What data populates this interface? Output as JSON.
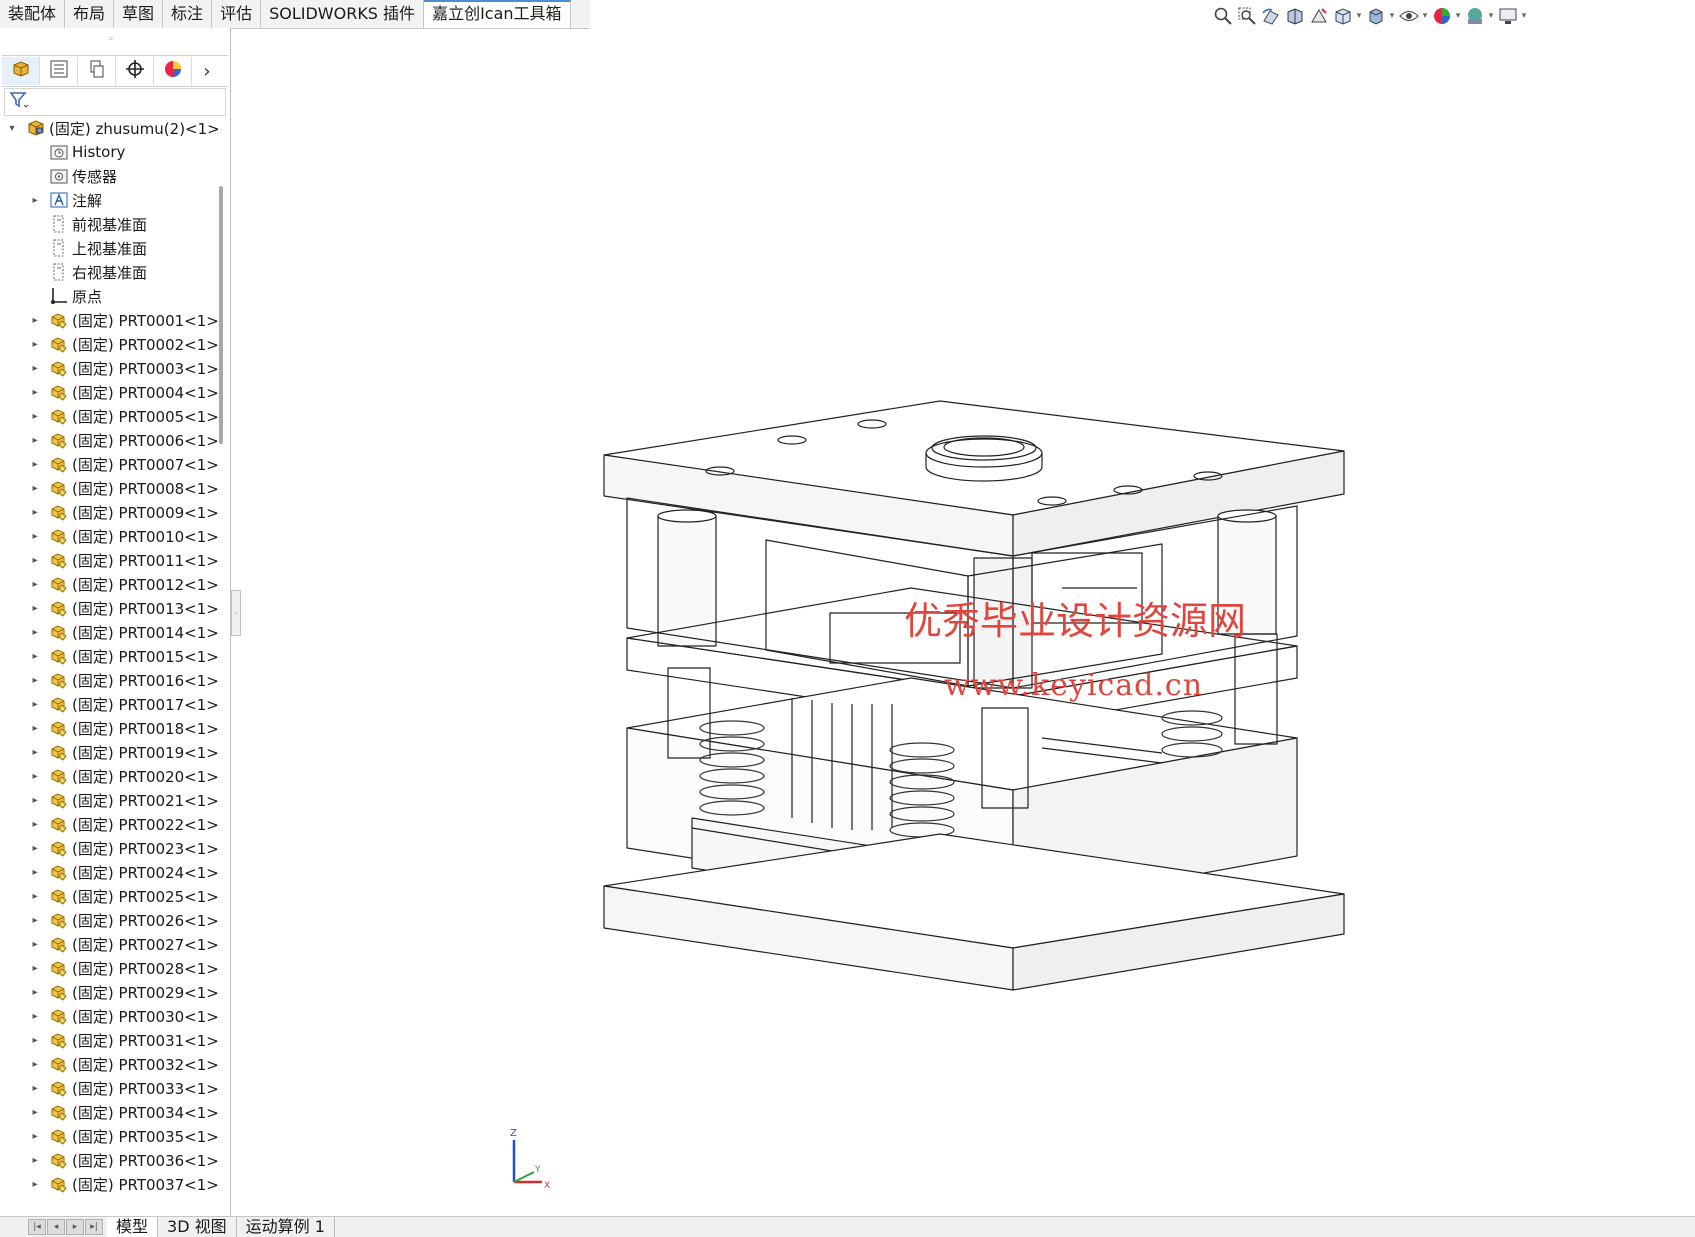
{
  "ribbon_tabs": [
    {
      "label": "装配体"
    },
    {
      "label": "布局"
    },
    {
      "label": "草图"
    },
    {
      "label": "标注"
    },
    {
      "label": "评估"
    },
    {
      "label": "SOLIDWORKS 插件"
    },
    {
      "label": "嘉立创Ican工具箱",
      "active": true
    }
  ],
  "view_toolbar": [
    {
      "icon": "zoom-to-fit-icon"
    },
    {
      "icon": "zoom-to-area-icon"
    },
    {
      "icon": "previous-view-icon"
    },
    {
      "icon": "section-view-icon"
    },
    {
      "icon": "dynamic-annotation-icon"
    },
    {
      "icon": "view-orientation-icon"
    },
    {
      "icon": "display-style-icon"
    },
    {
      "icon": "hide-show-items-icon"
    },
    {
      "icon": "edit-appearance-icon"
    },
    {
      "icon": "apply-scene-icon"
    },
    {
      "icon": "view-settings-icon"
    }
  ],
  "panel_tabs": [
    {
      "icon": "featuremanager-tree-icon",
      "active": true
    },
    {
      "icon": "property-manager-icon"
    },
    {
      "icon": "configuration-manager-icon"
    },
    {
      "icon": "dimxpert-manager-icon"
    },
    {
      "icon": "display-manager-icon"
    }
  ],
  "tree": {
    "root": "(固定) zhusumu(2)<1>",
    "items": [
      {
        "label": "History",
        "icon": "history-folder-icon",
        "expander": false
      },
      {
        "label": "传感器",
        "icon": "sensor-folder-icon",
        "expander": false
      },
      {
        "label": "注解",
        "icon": "annotation-folder-icon",
        "expander": true
      },
      {
        "label": "前视基准面",
        "icon": "plane-icon",
        "expander": false
      },
      {
        "label": "上视基准面",
        "icon": "plane-icon",
        "expander": false
      },
      {
        "label": "右视基准面",
        "icon": "plane-icon",
        "expander": false
      },
      {
        "label": "原点",
        "icon": "origin-icon",
        "expander": false
      }
    ],
    "parts": [
      "(固定) PRT0001<1>",
      "(固定) PRT0002<1>",
      "(固定) PRT0003<1>",
      "(固定) PRT0004<1>",
      "(固定) PRT0005<1>",
      "(固定) PRT0006<1>",
      "(固定) PRT0007<1>",
      "(固定) PRT0008<1>",
      "(固定) PRT0009<1>",
      "(固定) PRT0010<1>",
      "(固定) PRT0011<1>",
      "(固定) PRT0012<1>",
      "(固定) PRT0013<1>",
      "(固定) PRT0014<1>",
      "(固定) PRT0015<1>",
      "(固定) PRT0016<1>",
      "(固定) PRT0017<1>",
      "(固定) PRT0018<1>",
      "(固定) PRT0019<1>",
      "(固定) PRT0020<1>",
      "(固定) PRT0021<1>",
      "(固定) PRT0022<1>",
      "(固定) PRT0023<1>",
      "(固定) PRT0024<1>",
      "(固定) PRT0025<1>",
      "(固定) PRT0026<1>",
      "(固定) PRT0027<1>",
      "(固定) PRT0028<1>",
      "(固定) PRT0029<1>",
      "(固定) PRT0030<1>",
      "(固定) PRT0031<1>",
      "(固定) PRT0032<1>",
      "(固定) PRT0033<1>",
      "(固定) PRT0034<1>",
      "(固定) PRT0035<1>",
      "(固定) PRT0036<1>",
      "(固定) PRT0037<1>"
    ]
  },
  "bottom_tabs": [
    {
      "label": "模型",
      "active": true
    },
    {
      "label": "3D 视图"
    },
    {
      "label": "运动算例 1"
    }
  ],
  "watermark": {
    "line1": "优秀毕业设计资源网",
    "line2": "www.keyicad.cn"
  },
  "triad": {
    "z": "Z",
    "y": "Y",
    "x": "X"
  },
  "colors": {
    "watermark": "#e0463e",
    "part_icon": "#e8b53a",
    "assembly_icon": "#d9a82f",
    "active_tab_accent": "#4a90d0"
  }
}
